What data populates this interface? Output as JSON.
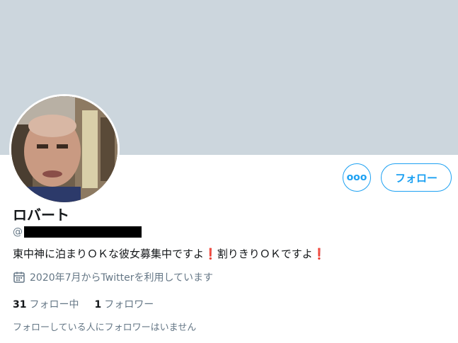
{
  "profile": {
    "display_name": "ロバート",
    "handle_prefix": "@",
    "bio_part1": "東中神に泊まりＯＫな彼女募集中ですよ",
    "bio_part2": "割りきりＯＫですよ",
    "bio_emoji": "❗",
    "joined": "2020年7月からTwitterを利用しています"
  },
  "buttons": {
    "more_label": "ooo",
    "follow_label": "フォロー"
  },
  "stats": {
    "following_count": "31",
    "following_label": "フォロー中",
    "followers_count": "1",
    "followers_label": "フォロワー"
  },
  "mutual_text": "フォローしている人にフォロワーはいません",
  "colors": {
    "accent": "#1da1f2",
    "banner": "#ccd6dd",
    "secondary_text": "#657786",
    "emoji_red": "#dd2e44"
  },
  "icons": [
    "more-icon",
    "calendar-icon"
  ]
}
